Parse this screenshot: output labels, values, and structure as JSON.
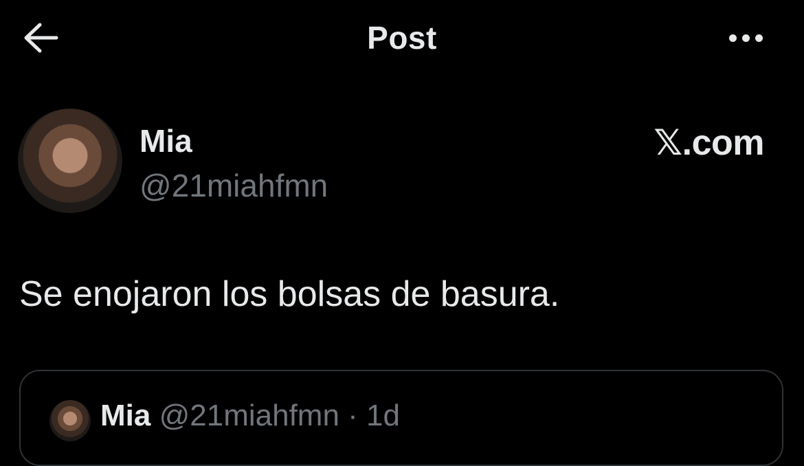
{
  "header": {
    "title": "Post",
    "back_icon": "arrow-left-icon",
    "more_icon": "more-horizontal-icon"
  },
  "author": {
    "name": "Mia",
    "handle": "@21miahfmn",
    "avatar_icon": "avatar-photo"
  },
  "watermark": {
    "text": "𝕏.com"
  },
  "post": {
    "text": "Se enojaron los bolsas de basura."
  },
  "quoted_post": {
    "name": "Mia",
    "handle": "@21miahfmn",
    "separator": "·",
    "time": "1d"
  },
  "colors": {
    "background": "#000000",
    "primary_text": "#e7e9ea",
    "secondary_text": "#71767b",
    "border": "#2f3336"
  }
}
